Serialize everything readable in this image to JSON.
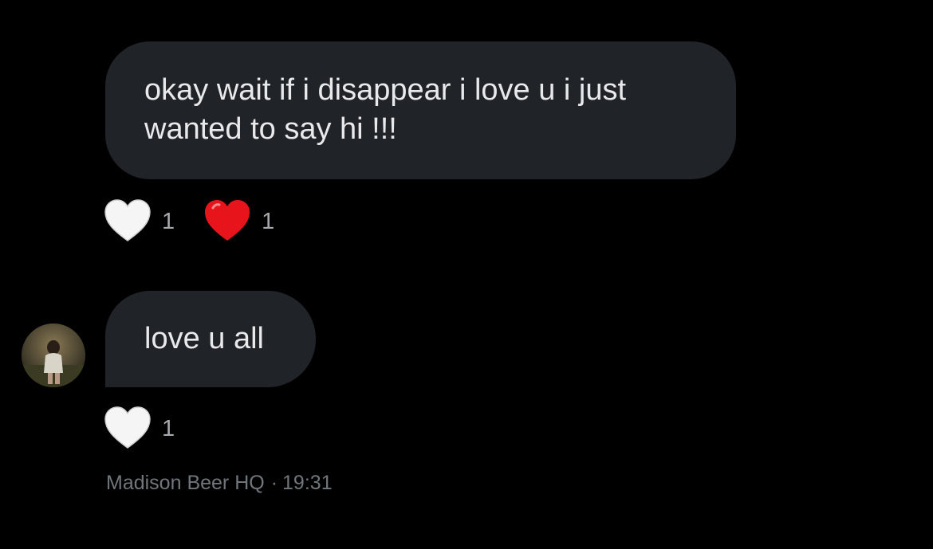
{
  "messages": [
    {
      "text": "okay wait if i disappear i love u i just wanted to say hi !!!",
      "reactions": [
        {
          "icon": "white-heart-icon",
          "color": "#f5f5f5",
          "count": "1"
        },
        {
          "icon": "red-heart-icon",
          "color": "#e8141b",
          "count": "1"
        }
      ]
    },
    {
      "text": "love u all",
      "reactions": [
        {
          "icon": "white-heart-icon",
          "color": "#f5f5f5",
          "count": "1"
        }
      ]
    }
  ],
  "meta": {
    "sender": "Madison Beer HQ",
    "separator": "·",
    "time": "19:31"
  },
  "colors": {
    "background": "#000000",
    "bubble": "#202327",
    "text": "#e7e9ea",
    "muted": "#71767b"
  }
}
